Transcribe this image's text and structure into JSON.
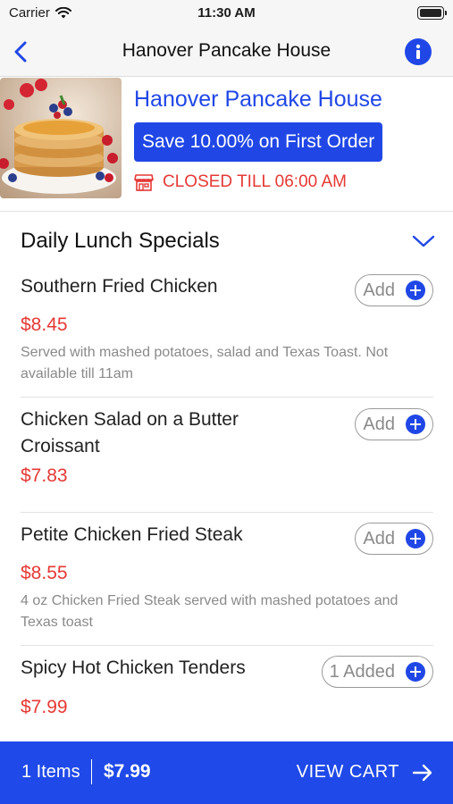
{
  "status_bar": {
    "carrier": "Carrier",
    "time": "11:30 AM"
  },
  "nav": {
    "title": "Hanover Pancake House"
  },
  "restaurant": {
    "name": "Hanover Pancake House",
    "promo": "Save 10.00% on First Order",
    "status": "CLOSED TILL 06:00 AM"
  },
  "section": {
    "title": "Daily Lunch Specials"
  },
  "items": [
    {
      "name": "Southern Fried Chicken",
      "price": "$8.45",
      "description": "Served with mashed potatoes, salad and Texas Toast. Not available till 11am",
      "button": "Add"
    },
    {
      "name": "Chicken Salad on a Butter Croissant",
      "price": "$7.83",
      "description": "",
      "button": "Add"
    },
    {
      "name": "Petite Chicken Fried Steak",
      "price": "$8.55",
      "description": "4 oz Chicken Fried Steak served with mashed potatoes and Texas toast",
      "button": "Add"
    },
    {
      "name": "Spicy Hot Chicken Tenders",
      "price": "$7.99",
      "description": "",
      "button": "1 Added"
    }
  ],
  "cart": {
    "count": "1 Items",
    "total": "$7.99",
    "action": "VIEW CART"
  },
  "colors": {
    "accent": "#2047e6",
    "price": "#e53935",
    "closed": "#e53935"
  }
}
